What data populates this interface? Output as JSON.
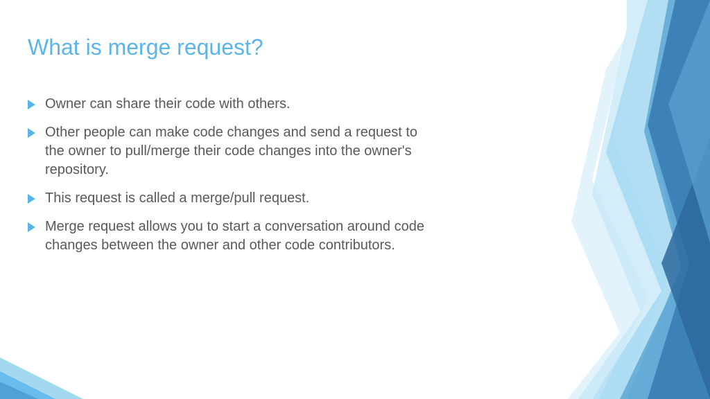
{
  "slide": {
    "title": "What is merge request?",
    "bullets": [
      "Owner can share their code with others.",
      "Other people can make code changes and send a request to the owner to pull/merge their code changes into the owner's repository.",
      "This request is called a merge/pull request.",
      "Merge request allows you to start a conversation around code changes between the owner and other code contributors."
    ]
  }
}
